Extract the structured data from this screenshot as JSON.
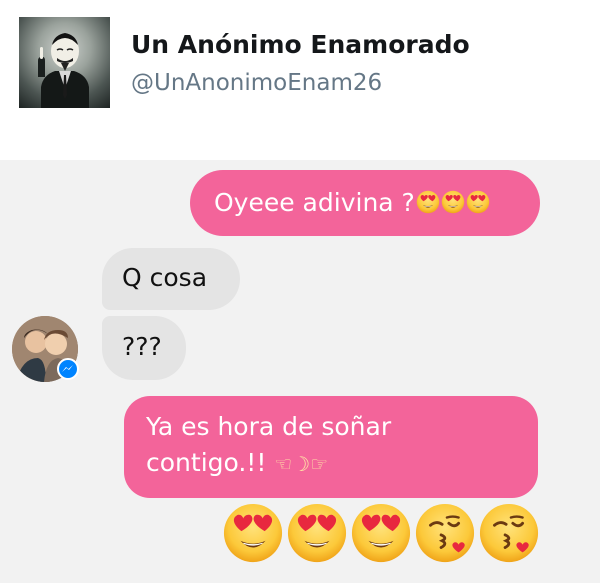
{
  "profile": {
    "display_name": "Un Anónimo Enamorado",
    "handle": "@UnAnonimoEnam26"
  },
  "messages": [
    {
      "direction": "outgoing",
      "text": "Oyeee adivina ?",
      "emoji": [
        "heart-eyes-icon",
        "heart-eyes-icon",
        "heart-eyes-icon"
      ]
    },
    {
      "direction": "incoming",
      "text": "Q cosa"
    },
    {
      "direction": "incoming",
      "text": "???"
    },
    {
      "direction": "outgoing",
      "lines": [
        "Ya es hora de soñar",
        "contigo.!!"
      ],
      "emoji": [
        "hand-pointing-left-icon",
        "crescent-moon-icon",
        "hand-pointing-right-icon"
      ]
    },
    {
      "direction": "outgoing",
      "type": "emoji-only",
      "emoji": [
        "heart-eyes-icon",
        "heart-eyes-icon",
        "heart-eyes-icon",
        "kissing-heart-icon",
        "kissing-heart-icon"
      ]
    }
  ],
  "colors": {
    "outgoing_bubble": "#f3649a",
    "incoming_bubble": "#e4e4e4",
    "chat_background": "#f2f2f2",
    "messenger_badge": "#0084ff"
  }
}
